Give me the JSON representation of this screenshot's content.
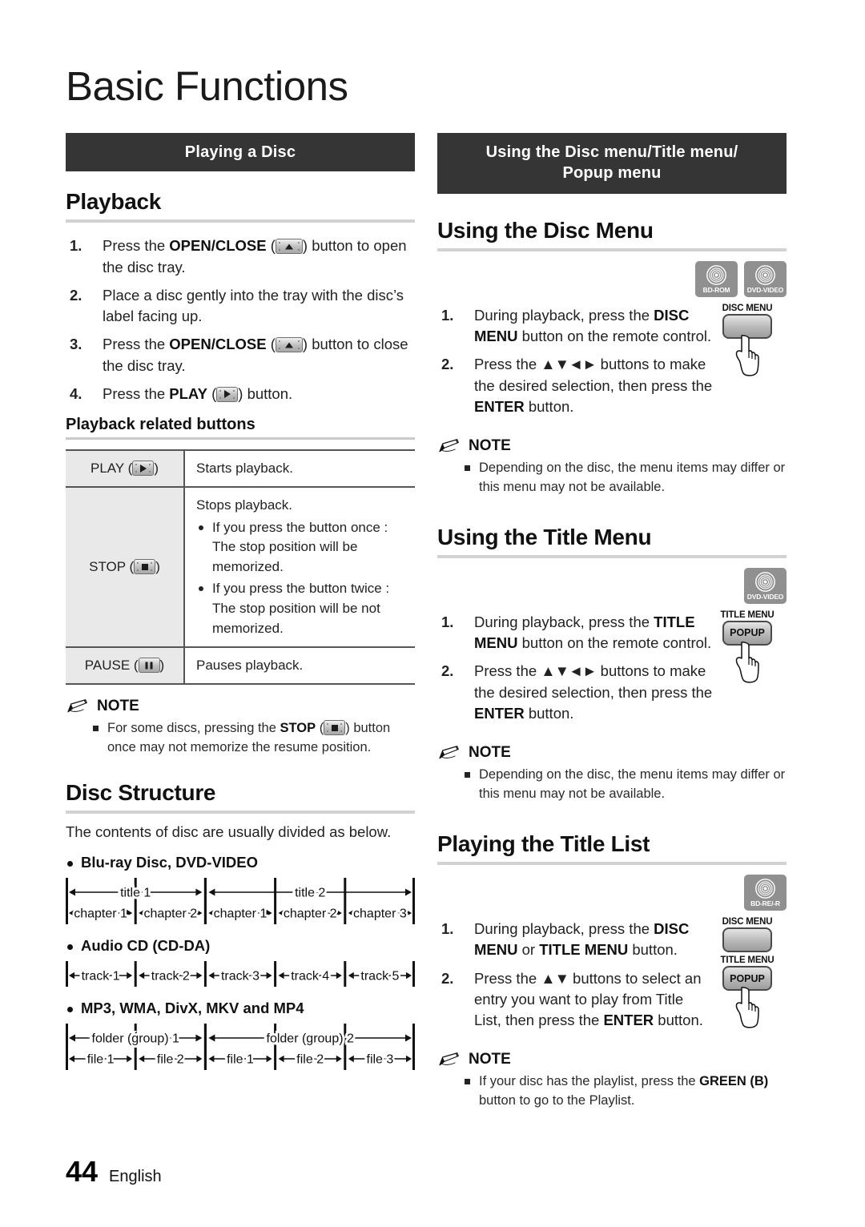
{
  "page": {
    "chapter_title": "Basic Functions",
    "page_number": "44",
    "language": "English"
  },
  "left": {
    "banner": "Playing a Disc",
    "playback": {
      "heading": "Playback",
      "steps": [
        {
          "num": "1.",
          "html": "Press the <b>OPEN/CLOSE</b> (<span class=\"key\"><span class=\"dot tl\"></span><span class=\"dot tr\"></span><span class=\"dot bl\"></span><span class=\"dot br\"></span><span class=\"tri-up\"></span></span>) button to open the disc tray."
        },
        {
          "num": "2.",
          "html": "Place a disc gently into the tray with the disc’s label facing up."
        },
        {
          "num": "3.",
          "html": "Press the <b>OPEN/CLOSE</b> (<span class=\"key\"><span class=\"dot tl\"></span><span class=\"dot tr\"></span><span class=\"dot bl\"></span><span class=\"dot br\"></span><span class=\"tri-up\"></span></span>) button to close the disc tray."
        },
        {
          "num": "4.",
          "html": "Press the <b>PLAY</b> (<span class=\"key sq\"><span class=\"dot tl\"></span><span class=\"dot tr\"></span><span class=\"dot bl\"></span><span class=\"dot br\"></span><span class=\"tri-right\"></span></span>) button."
        }
      ]
    },
    "buttons_table": {
      "heading": "Playback related buttons",
      "rows": [
        {
          "label_text": "PLAY",
          "label_icon": "play-key-icon",
          "desc_main": "Starts playback.",
          "desc_bullets": []
        },
        {
          "label_text": "STOP",
          "label_icon": "stop-key-icon",
          "desc_main": "Stops playback.",
          "desc_bullets": [
            "If you press the button once : The stop position will be memorized.",
            "If you press the button twice : The stop position will be not memorized."
          ]
        },
        {
          "label_text": "PAUSE",
          "label_icon": "pause-key-icon",
          "desc_main": "Pauses playback.",
          "desc_bullets": []
        }
      ]
    },
    "note": {
      "title": "NOTE",
      "items_html": [
        "For some discs, pressing the <b>STOP</b> (<span class=\"key sq\"><span class=\"dot tl\"></span><span class=\"dot tr\"></span><span class=\"dot bl\"></span><span class=\"dot br\"></span><span class=\"sqr\"></span></span>) button once may not memorize the resume position."
      ]
    },
    "disc_structure": {
      "heading": "Disc Structure",
      "intro": "The contents of disc are usually divided as below.",
      "groups": [
        {
          "title": "Blu-ray Disc, DVD-VIDEO",
          "diagram": "title-chapter",
          "top_row": [
            "title 1",
            "title 2"
          ],
          "bottom_row": [
            "chapter 1",
            "chapter 2",
            "chapter 1",
            "chapter 2",
            "chapter 3"
          ]
        },
        {
          "title": "Audio CD (CD-DA)",
          "diagram": "tracks",
          "top_row": [],
          "bottom_row": [
            "track 1",
            "track 2",
            "track 3",
            "track 4",
            "track 5"
          ]
        },
        {
          "title": "MP3, WMA, DivX, MKV and MP4",
          "diagram": "folder-file",
          "top_row": [
            "folder (group) 1",
            "folder (group) 2"
          ],
          "bottom_row": [
            "file 1",
            "file 2",
            "file 1",
            "file 2",
            "file 3"
          ]
        }
      ]
    }
  },
  "right": {
    "banner_line1": "Using the Disc menu/Title menu/",
    "banner_line2": "Popup menu",
    "sections": [
      {
        "heading": "Using the Disc Menu",
        "media_icons": [
          {
            "label": "BD-ROM",
            "name": "bd-rom-icon"
          },
          {
            "label": "DVD-VIDEO",
            "name": "dvd-video-icon"
          }
        ],
        "remote_keys": [
          {
            "label": "DISC MENU",
            "face": ""
          }
        ],
        "steps": [
          {
            "num": "1.",
            "html": "During playback, press the <b>DISC MENU</b> button on the remote control."
          },
          {
            "num": "2.",
            "html": "Press the <span class=\"arrows\">▲▼◄►</span> buttons to make the desired selection, then press the <b>ENTER</b> button."
          }
        ],
        "note": {
          "title": "NOTE",
          "items_html": [
            "Depending on the disc, the menu items may differ or this menu may not be available."
          ]
        }
      },
      {
        "heading": "Using the Title Menu",
        "media_icons": [
          {
            "label": "DVD-VIDEO",
            "name": "dvd-video-icon"
          }
        ],
        "remote_keys": [
          {
            "label": "TITLE MENU",
            "face": "POPUP"
          }
        ],
        "steps": [
          {
            "num": "1.",
            "html": "During playback, press the <b>TITLE MENU</b> button on the remote control."
          },
          {
            "num": "2.",
            "html": "Press the <span class=\"arrows\">▲▼◄►</span> buttons to make the desired selection, then press the <b>ENTER</b> button."
          }
        ],
        "note": {
          "title": "NOTE",
          "items_html": [
            "Depending on the disc, the menu items may differ or this menu may not be available."
          ]
        }
      },
      {
        "heading": "Playing the Title List",
        "media_icons": [
          {
            "label": "BD-RE/-R",
            "name": "bd-re-r-icon"
          }
        ],
        "remote_keys": [
          {
            "label": "DISC MENU",
            "face": ""
          },
          {
            "label": "TITLE MENU",
            "face": "POPUP"
          }
        ],
        "steps": [
          {
            "num": "1.",
            "html": "During playback, press the <b>DISC MENU</b> or <b>TITLE MENU</b> button."
          },
          {
            "num": "2.",
            "html": "Press the <span class=\"arrows\">▲▼</span> buttons to select an entry you want to play from Title List, then press the <b>ENTER</b> button."
          }
        ],
        "note": {
          "title": "NOTE",
          "items_html": [
            "If your disc has the playlist, press the <b>GREEN (B)</b> button to go to the Playlist."
          ]
        }
      }
    ]
  }
}
